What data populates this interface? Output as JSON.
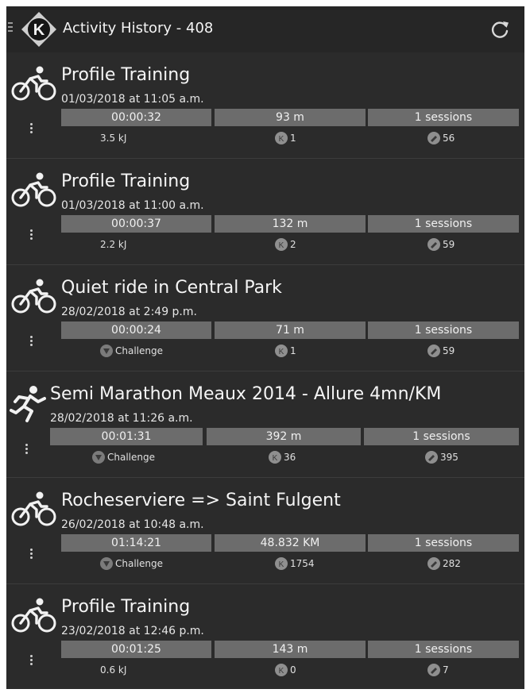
{
  "header": {
    "title": "Activity History - 408",
    "logo_letter": "K"
  },
  "colors": {
    "background": "#2b2b2b",
    "stat_box": "#6c6c6c",
    "text": "#f2f2f2"
  },
  "activities": [
    {
      "sport": "cycling-icon",
      "title": "Profile Training",
      "date": "01/03/2018 at 11:05 a.m.",
      "duration": "00:00:32",
      "distance": "93 m",
      "sessions": "1 sessions",
      "detail": "3.5 kJ",
      "detail_icon": "",
      "metric_a": "1",
      "metric_b": "56"
    },
    {
      "sport": "cycling-icon",
      "title": "Profile Training",
      "date": "01/03/2018 at 11:00 a.m.",
      "duration": "00:00:37",
      "distance": "132 m",
      "sessions": "1 sessions",
      "detail": "2.2 kJ",
      "detail_icon": "",
      "metric_a": "2",
      "metric_b": "59"
    },
    {
      "sport": "cycling-icon",
      "title": "Quiet ride in Central Park",
      "date": "28/02/2018 at 2:49 p.m.",
      "duration": "00:00:24",
      "distance": "71 m",
      "sessions": "1 sessions",
      "detail": "Challenge",
      "detail_icon": "challenge-icon",
      "metric_a": "1",
      "metric_b": "59"
    },
    {
      "sport": "running-icon",
      "title": "Semi Marathon Meaux 2014 - Allure 4mn/KM",
      "date": "28/02/2018 at 11:26 a.m.",
      "duration": "00:01:31",
      "distance": "392 m",
      "sessions": "1 sessions",
      "detail": "Challenge",
      "detail_icon": "challenge-icon",
      "metric_a": "36",
      "metric_b": "395"
    },
    {
      "sport": "cycling-icon",
      "title": "Rocheserviere => Saint Fulgent",
      "date": "26/02/2018 at 10:48 a.m.",
      "duration": "01:14:21",
      "distance": "48.832 KM",
      "sessions": "1 sessions",
      "detail": "Challenge",
      "detail_icon": "challenge-icon",
      "metric_a": "1754",
      "metric_b": "282"
    },
    {
      "sport": "cycling-icon",
      "title": "Profile Training",
      "date": "23/02/2018 at 12:46 p.m.",
      "duration": "00:01:25",
      "distance": "143 m",
      "sessions": "1 sessions",
      "detail": "0.6 kJ",
      "detail_icon": "",
      "metric_a": "0",
      "metric_b": "7"
    }
  ]
}
